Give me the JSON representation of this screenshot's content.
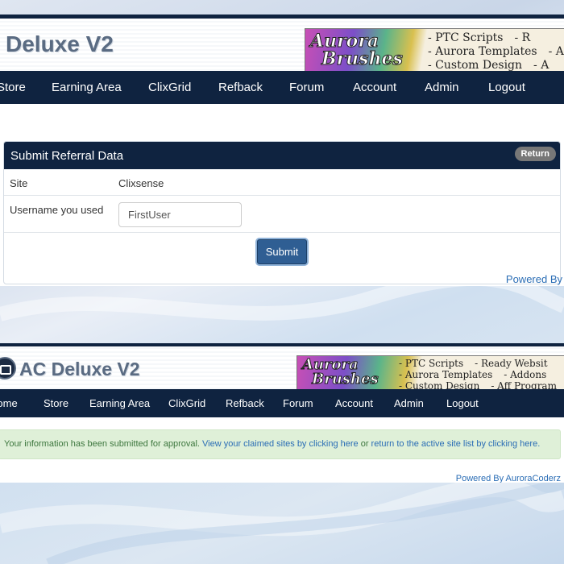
{
  "colors": {
    "nav_bg": "#0f2340",
    "link": "#2a6db5",
    "success_bg": "#dff0d8",
    "success_text": "#3c763d",
    "button": "#2f5e93"
  },
  "screen1": {
    "site_title": "Deluxe V2",
    "banner": {
      "brand_line1": "Aurora",
      "brand_line2": "Brushes",
      "items": [
        "- PTC Scripts",
        "- Aurora Templates",
        "- Custom Design"
      ],
      "items_cut": [
        "- R",
        "- A",
        "- A"
      ]
    },
    "nav": [
      "Store",
      "Earning Area",
      "ClixGrid",
      "Refback",
      "Forum",
      "Account",
      "Admin",
      "Logout"
    ],
    "panel": {
      "title": "Submit Referral Data",
      "return_label": "Return",
      "site_label": "Site",
      "site_value": "Clixsense",
      "username_label": "Username you used",
      "username_value": "FirstUser",
      "submit_label": "Submit"
    },
    "powered": "Powered By"
  },
  "screen2": {
    "site_title": "AC Deluxe V2",
    "banner": {
      "brand_line1": "Aurora",
      "brand_line2": "Brushes",
      "items": [
        "- PTC Scripts",
        "- Aurora Templates",
        "- Custom Design"
      ],
      "items_right": [
        "- Ready Websit",
        "- Addons",
        "- Aff Program"
      ]
    },
    "nav": [
      "Home",
      "Store",
      "Earning Area",
      "ClixGrid",
      "Refback",
      "Forum",
      "Account",
      "Admin",
      "Logout"
    ],
    "alert": {
      "prefix": "Your information has been submitted for approval.",
      "link1": "View your claimed sites by clicking here",
      "middle": "or",
      "link2": "return to the active site list by clicking here."
    },
    "powered": "Powered By AuroraCoderz"
  }
}
